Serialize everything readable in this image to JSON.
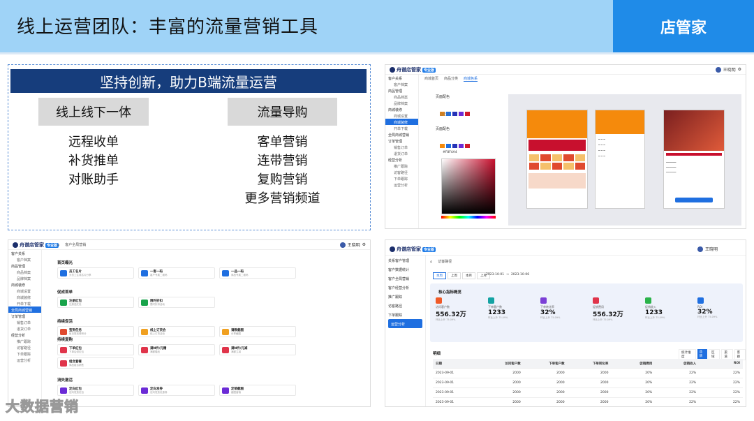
{
  "header": {
    "title": "线上运营团队：丰富的流量营销工具",
    "brand": "店管家"
  },
  "slogan": {
    "banner": "坚持创新，助力B端流量运营",
    "left_title": "线上线下一体",
    "left_items": [
      "远程收单",
      "补货推单",
      "对账助手"
    ],
    "right_title": "流量导购",
    "right_items": [
      "客单营销",
      "连带营销",
      "复购营销",
      "更多营销频道"
    ]
  },
  "app": {
    "logo": "舟谱店管家",
    "logo_tag": "专业版",
    "user": "王晓明"
  },
  "shot_a": {
    "sidebar": [
      {
        "label": "客户关系",
        "sub": false,
        "active": false
      },
      {
        "label": "客户档案",
        "sub": true,
        "active": false
      },
      {
        "label": "商品管理",
        "sub": false,
        "active": false
      },
      {
        "label": "商品档案",
        "sub": true,
        "active": false
      },
      {
        "label": "品牌档案",
        "sub": true,
        "active": false
      },
      {
        "label": "商城装修",
        "sub": false,
        "active": false
      },
      {
        "label": "商城设置",
        "sub": true,
        "active": false
      },
      {
        "label": "商城装修",
        "sub": true,
        "active": true
      },
      {
        "label": "开单下载",
        "sub": true,
        "active": false
      },
      {
        "label": "全局商城营销",
        "sub": false,
        "active": false
      },
      {
        "label": "订单管理",
        "sub": false,
        "active": false
      },
      {
        "label": "销售订单",
        "sub": true,
        "active": false
      },
      {
        "label": "退货订单",
        "sub": true,
        "active": false
      },
      {
        "label": "经营分析",
        "sub": false,
        "active": false
      },
      {
        "label": "推广跟踪",
        "sub": true,
        "active": false
      },
      {
        "label": "访客路径",
        "sub": true,
        "active": false
      },
      {
        "label": "下单跟踪",
        "sub": true,
        "active": false
      },
      {
        "label": "运营分析",
        "sub": true,
        "active": false
      }
    ],
    "tabs": [
      "商城首页",
      "商品分类",
      "商城色系"
    ],
    "label_theme": "页面配色",
    "label_custom": "自定义",
    "hex": "#F8F4A4",
    "colors": [
      "#f58a0c",
      "#1f6fe0",
      "#2432b8",
      "#6b2bd6",
      "#d11a2a"
    ]
  },
  "shot_b": {
    "sidebar": [
      {
        "label": "客户关系",
        "sub": false,
        "active": false
      },
      {
        "label": "客户档案",
        "sub": true,
        "active": false
      },
      {
        "label": "商品管理",
        "sub": false,
        "active": false
      },
      {
        "label": "商品档案",
        "sub": true,
        "active": false
      },
      {
        "label": "品牌档案",
        "sub": true,
        "active": false
      },
      {
        "label": "商城装修",
        "sub": false,
        "active": false
      },
      {
        "label": "商城设置",
        "sub": true,
        "active": false
      },
      {
        "label": "商城装修",
        "sub": true,
        "active": false
      },
      {
        "label": "开单下载",
        "sub": true,
        "active": false
      },
      {
        "label": "全局商城营销",
        "sub": false,
        "active": true
      },
      {
        "label": "订单管理",
        "sub": false,
        "active": false
      },
      {
        "label": "销售订单",
        "sub": true,
        "active": false
      },
      {
        "label": "退货订单",
        "sub": true,
        "active": false
      },
      {
        "label": "经营分析",
        "sub": false,
        "active": false
      },
      {
        "label": "推广跟踪",
        "sub": true,
        "active": false
      },
      {
        "label": "访客路径",
        "sub": true,
        "active": false
      },
      {
        "label": "下单跟踪",
        "sub": true,
        "active": false
      },
      {
        "label": "运营分析",
        "sub": true,
        "active": false
      }
    ],
    "tab": "客户全局营销",
    "sections": [
      {
        "title": "首页曝光",
        "cards": [
          {
            "t": "员工名片",
            "d": "为员工生成名片分享",
            "color": "#1f6fe0"
          },
          {
            "t": "一客一码",
            "d": "客户专属二维码",
            "color": "#1f6fe0"
          },
          {
            "t": "一品一码",
            "d": "商品专属二维码",
            "color": "#1f6fe0"
          }
        ]
      },
      {
        "title": "促成首单",
        "cards": [
          {
            "t": "注册红包",
            "d": "注册送红包",
            "color": "#18a34a"
          },
          {
            "t": "限时折扣",
            "d": "限时折扣活动",
            "color": "#18a34a"
          }
        ]
      },
      {
        "title": "持续促活",
        "cards": [
          {
            "t": "签到任务",
            "d": "每日签到得积分",
            "color": "#e04a2f"
          },
          {
            "t": "线上订货会",
            "d": "线上订货活动",
            "color": "#f0a020"
          },
          {
            "t": "请教截图",
            "d": "分享截图",
            "color": "#f0a020"
          }
        ]
      },
      {
        "title": "持续复购",
        "cards": [
          {
            "t": "下单红包",
            "d": "下单后领红包",
            "color": "#e0344a"
          },
          {
            "t": "满N件/元赠",
            "d": "满额赠品",
            "color": "#e0344a"
          },
          {
            "t": "满N件/元减",
            "d": "满额立减",
            "color": "#e0344a"
          },
          {
            "t": "组合套餐",
            "d": "商品组合销售",
            "color": "#e0344a"
          }
        ]
      },
      {
        "title": "流失激活",
        "cards": [
          {
            "t": "定向红包",
            "d": "定向发放红包",
            "color": "#6b2bd6"
          },
          {
            "t": "定向发券",
            "d": "定向发放优惠券",
            "color": "#6b2bd6"
          },
          {
            "t": "定销截图",
            "d": "截图营销",
            "color": "#6b2bd6"
          }
        ]
      }
    ]
  },
  "shot_c": {
    "sidebar": [
      {
        "label": "关系客户管理",
        "active": false
      },
      {
        "label": "客户数据统计",
        "active": false
      },
      {
        "label": "客户全局营销",
        "active": false
      },
      {
        "label": "客户经营分析",
        "active": false
      },
      {
        "label": "推广跟踪",
        "active": false
      },
      {
        "label": "访客路径",
        "active": false
      },
      {
        "label": "下单跟踪",
        "active": false
      },
      {
        "label": "运营分析",
        "active": true
      }
    ],
    "tab": "访客路径",
    "periods": [
      "本周",
      "上周",
      "本月",
      "上月"
    ],
    "date_from": "2023-10-01",
    "date_to": "2023-10-06",
    "panel_title": "核心指标概览",
    "kpis": [
      {
        "label": "访问客户数",
        "value": "556.32万",
        "sub": "环比上升 75.09%",
        "color": "#f05a28"
      },
      {
        "label": "下单客户数",
        "value": "1233",
        "sub": "环比上升 75.09%",
        "color": "#14a3a3"
      },
      {
        "label": "下单转化率",
        "value": "32%",
        "sub": "环比上升 75.09%",
        "color": "#7b3fd6"
      },
      {
        "label": "促销费用",
        "value": "556.32万",
        "sub": "环比上升 75.09%",
        "color": "#e0344a"
      },
      {
        "label": "促销收入",
        "value": "1233",
        "sub": "环比上升 75.09%",
        "color": "#2bb34a"
      },
      {
        "label": "ROI",
        "value": "32%",
        "sub": "环比上升 75.09%",
        "color": "#1f6fe0"
      }
    ],
    "detail_title": "明细",
    "dims": [
      "统计维度",
      "品牌",
      "区域",
      "渠道",
      "客群"
    ],
    "headers": [
      "日期",
      "访问客户数",
      "下单客户数",
      "下单转化率",
      "促销费用",
      "促销收入",
      "ROI"
    ],
    "rows": [
      [
        "2023-09-01",
        "2000",
        "2000",
        "2000",
        "20%",
        "22%",
        "22%"
      ],
      [
        "2023-09-01",
        "2000",
        "2000",
        "2000",
        "20%",
        "22%",
        "22%"
      ],
      [
        "2023-09-01",
        "2000",
        "2000",
        "2000",
        "20%",
        "22%",
        "22%"
      ],
      [
        "2023-09-01",
        "2000",
        "2000",
        "2000",
        "20%",
        "22%",
        "22%"
      ],
      [
        "2023-09-01",
        "2000",
        "2000",
        "2000",
        "20%",
        "22%",
        "22%"
      ]
    ]
  },
  "watermark": "大数据营销"
}
